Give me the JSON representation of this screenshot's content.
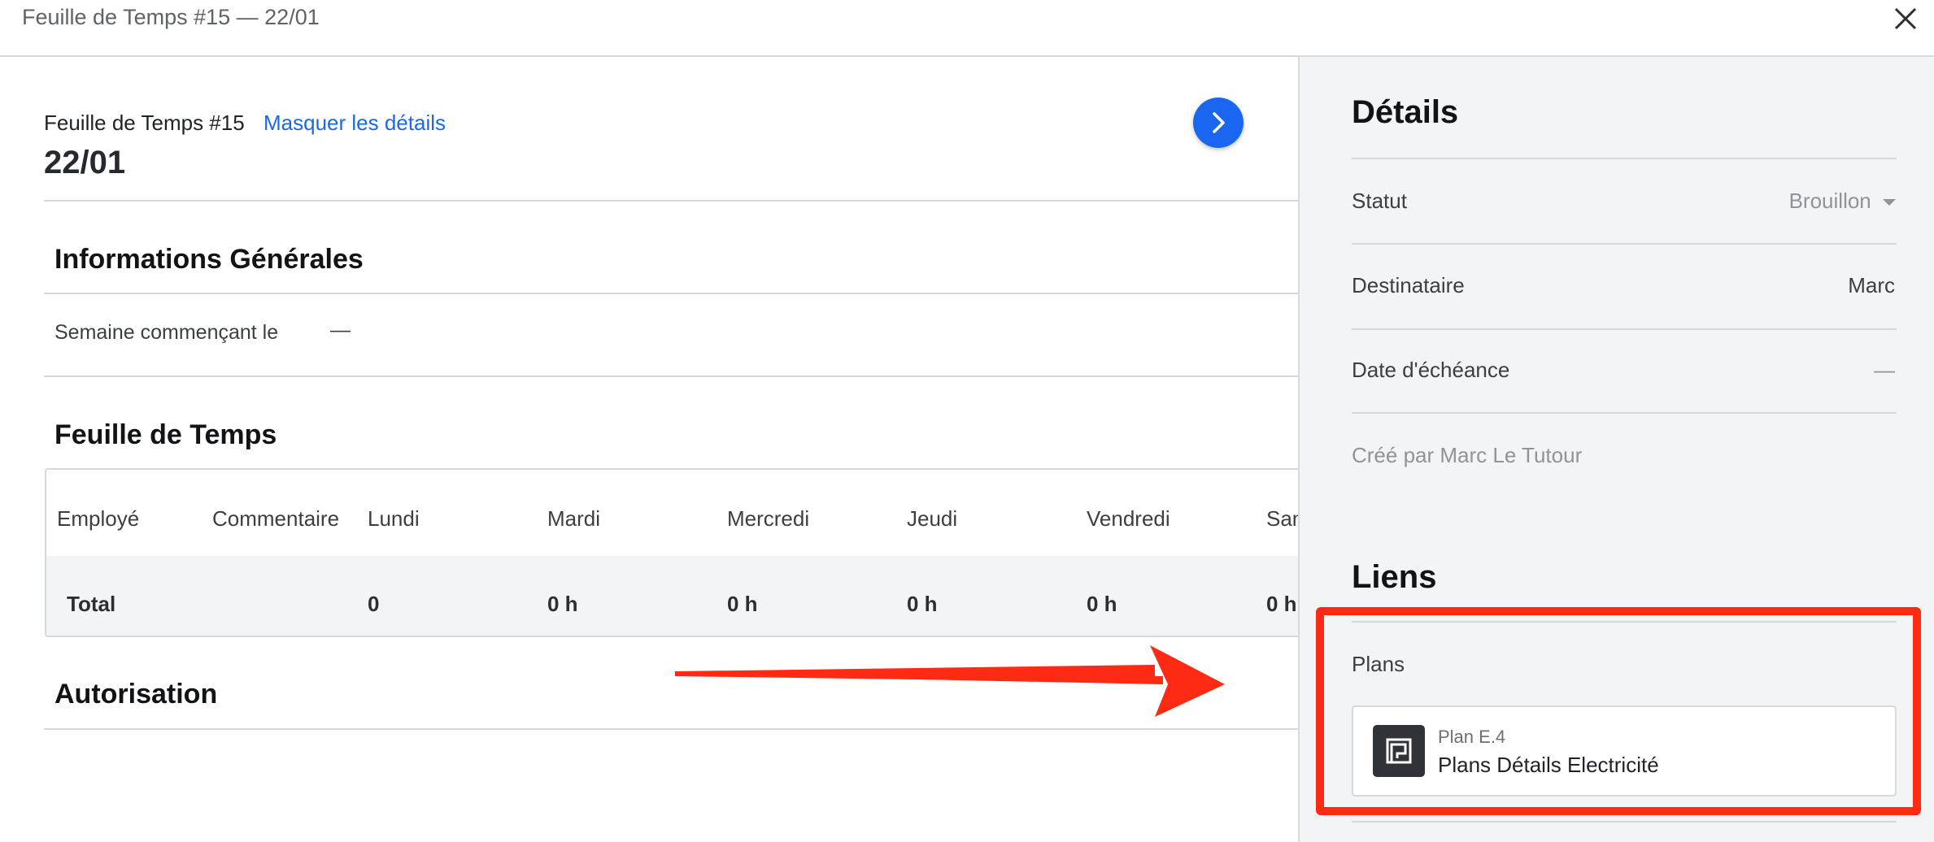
{
  "topbar": {
    "title": "Feuille de Temps #15 — 22/01",
    "close_icon": "close-icon"
  },
  "header": {
    "record_label": "Feuille de Temps #15",
    "hide_details_link": "Masquer les détails",
    "record_title": "22/01",
    "next_icon": "chevron-right-icon"
  },
  "general": {
    "title": "Informations Générales",
    "week_label": "Semaine commençant le",
    "week_value": "—"
  },
  "timesheet": {
    "title": "Feuille de Temps",
    "columns": [
      "Employé",
      "Commentaire",
      "Lundi",
      "Mardi",
      "Mercredi",
      "Jeudi",
      "Vendredi",
      "Sam"
    ],
    "total_row": {
      "label": "Total",
      "values": [
        "0",
        "0 h",
        "0 h",
        "0 h",
        "0 h",
        "0 h"
      ]
    }
  },
  "authorization": {
    "title": "Autorisation"
  },
  "details": {
    "title": "Détails",
    "status_label": "Statut",
    "status_value": "Brouillon",
    "recipient_label": "Destinataire",
    "recipient_value": "Marc",
    "due_label": "Date d'échéance",
    "due_value": "—",
    "created_by": "Créé par Marc Le Tutour"
  },
  "links": {
    "title": "Liens",
    "plans_label": "Plans",
    "plan": {
      "number": "Plan E.4",
      "name": "Plans Détails Electricité",
      "icon": "blueprint-icon"
    }
  },
  "annotation": {
    "color": "#ff2a14"
  }
}
